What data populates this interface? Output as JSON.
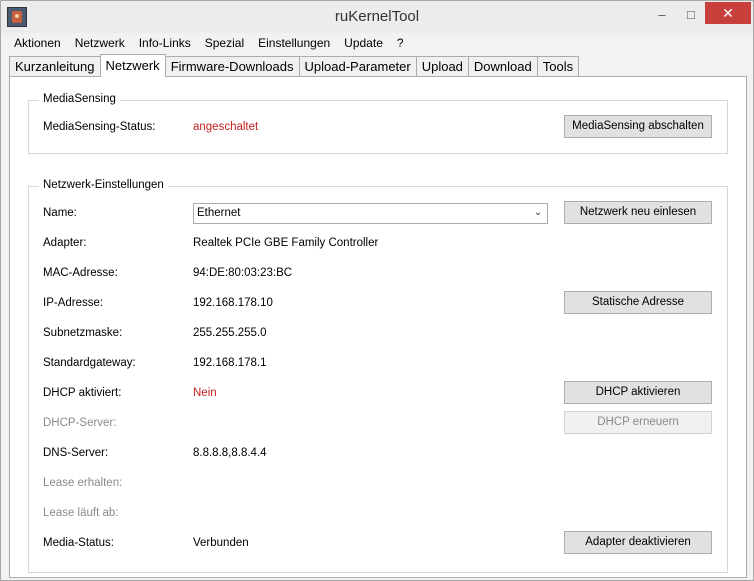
{
  "window": {
    "title": "ruKernelTool"
  },
  "titlebar_buttons": {
    "minimize": "–",
    "maximize": "□",
    "close": "✕"
  },
  "menu": [
    "Aktionen",
    "Netzwerk",
    "Info-Links",
    "Spezial",
    "Einstellungen",
    "Update",
    "?"
  ],
  "tabs": [
    "Kurzanleitung",
    "Netzwerk",
    "Firmware-Downloads",
    "Upload-Parameter",
    "Upload",
    "Download",
    "Tools"
  ],
  "active_tab": "Netzwerk",
  "mediasensing": {
    "group_title": "MediaSensing",
    "status_label": "MediaSensing-Status:",
    "status_value": "angeschaltet",
    "button": "MediaSensing abschalten"
  },
  "network": {
    "group_title": "Netzwerk-Einstellungen",
    "name_label": "Name:",
    "name_value": "Ethernet",
    "rescan_button": "Netzwerk neu einlesen",
    "adapter_label": "Adapter:",
    "adapter_value": "Realtek PCIe GBE Family Controller",
    "mac_label": "MAC-Adresse:",
    "mac_value": "94:DE:80:03:23:BC",
    "ip_label": "IP-Adresse:",
    "ip_value": "192.168.178.10",
    "static_button": "Statische Adresse",
    "subnet_label": "Subnetzmaske:",
    "subnet_value": "255.255.255.0",
    "gateway_label": "Standardgateway:",
    "gateway_value": "192.168.178.1",
    "dhcp_label": "DHCP aktiviert:",
    "dhcp_value": "Nein",
    "dhcp_activate_button": "DHCP aktivieren",
    "dhcp_server_label": "DHCP-Server:",
    "dhcp_renew_button": "DHCP erneuern",
    "dns_label": "DNS-Server:",
    "dns_value": "8.8.8.8,8.8.4.4",
    "lease_obtained_label": "Lease erhalten:",
    "lease_expires_label": "Lease läuft ab:",
    "media_status_label": "Media-Status:",
    "media_status_value": "Verbunden",
    "deactivate_button": "Adapter deaktivieren"
  },
  "colors": {
    "accent_red": "#c41e1e",
    "close_button": "#c7403c"
  }
}
